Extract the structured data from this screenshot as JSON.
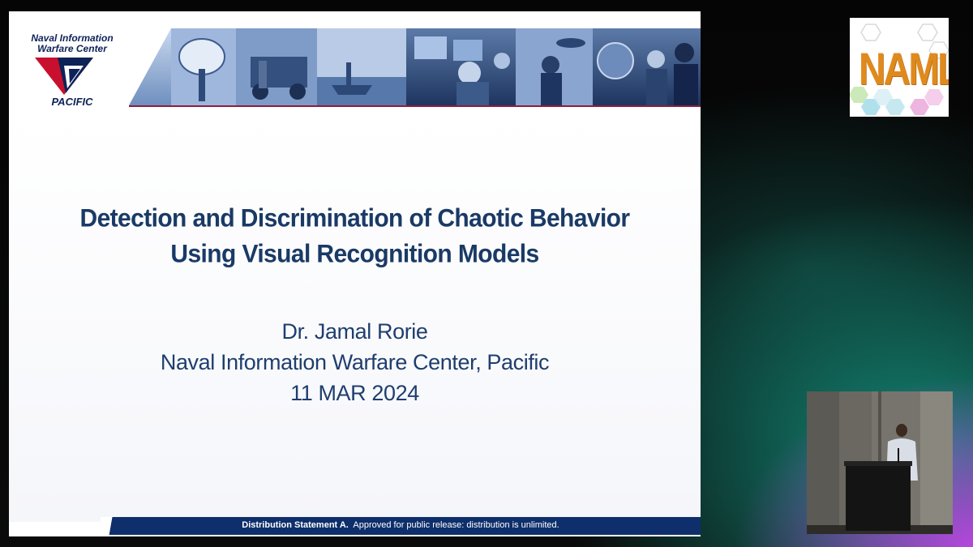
{
  "slide": {
    "org_logo": {
      "line1": "Naval Information",
      "line2": "Warfare Center",
      "line3": "PACIFIC",
      "colors": {
        "navy": "#0d2257",
        "red": "#c8102e"
      }
    },
    "title": {
      "line1": "Detection and Discrimination of Chaotic Behavior",
      "line2": "Using Visual Recognition Models"
    },
    "presenter": "Dr. Jamal Rorie",
    "affiliation": "Naval Information Warfare Center, Pacific",
    "date": "11 MAR 2024",
    "footer": {
      "label": "Distribution Statement A.",
      "text": "Approved for public release: distribution is unlimited."
    },
    "colors": {
      "title": "#1a3a66",
      "footer_bar": "#0e2f6b",
      "banner_rule": "#8e1c3c"
    }
  },
  "conference_logo": {
    "text": "NAML",
    "colors": {
      "letters": "#e08a1e",
      "hexagons": [
        "#9ed8e8",
        "#e8a3d8",
        "#b8e6b4"
      ]
    }
  },
  "speaker_video": {
    "icon": "speaker-at-podium"
  }
}
